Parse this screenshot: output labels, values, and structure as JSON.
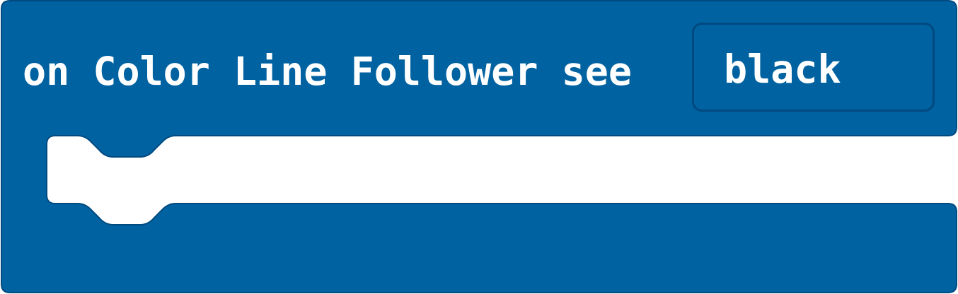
{
  "block": {
    "label": "on Color Line Follower see",
    "dropdown_value": "black",
    "color": "#0062a0",
    "border_color": "#004a80",
    "slot_color": "#ffffff"
  }
}
